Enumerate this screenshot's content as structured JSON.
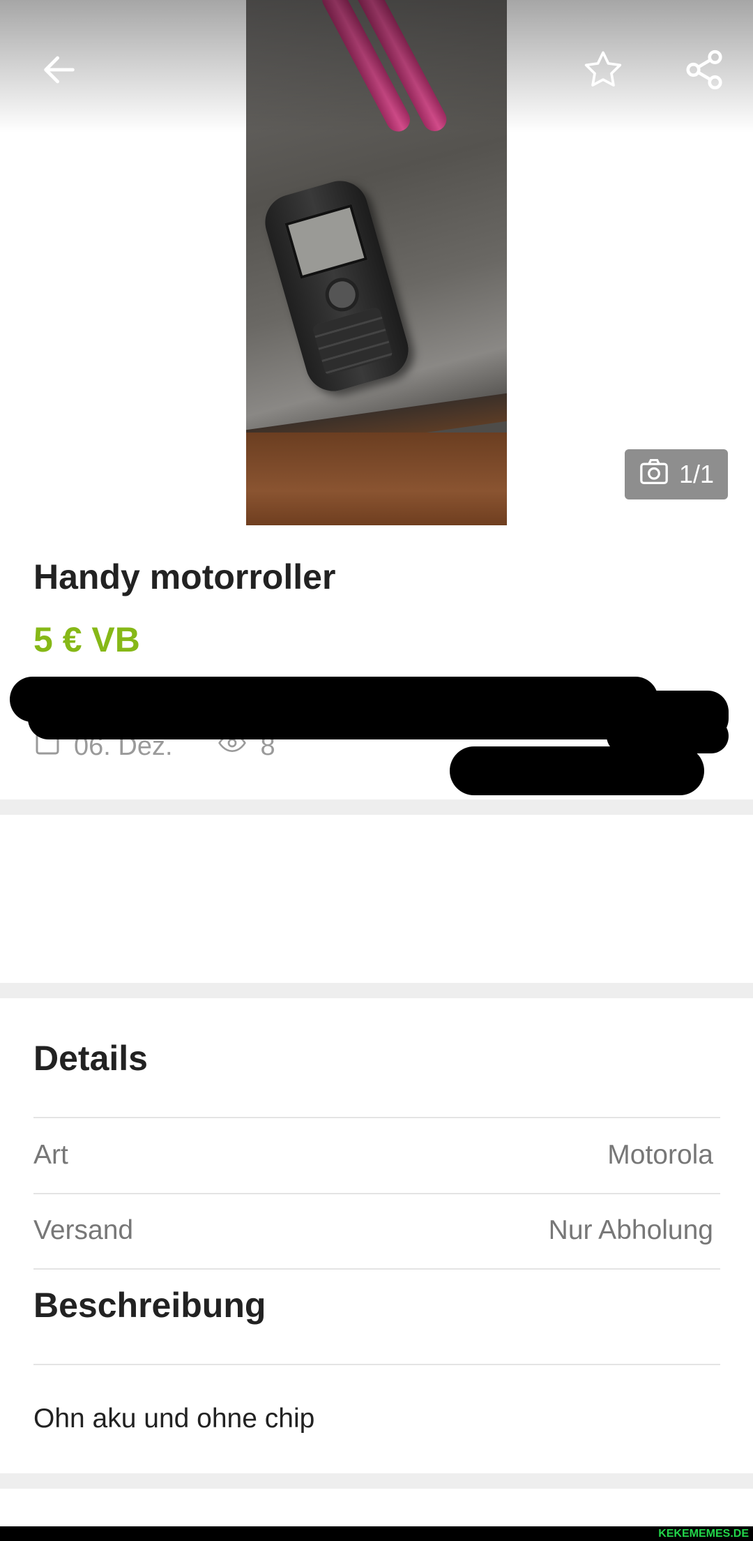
{
  "header": {
    "back_icon": "arrow-left-icon",
    "favorite_icon": "star-outline-icon",
    "share_icon": "share-icon"
  },
  "gallery": {
    "counter": "1/1",
    "counter_icon": "camera-icon"
  },
  "listing": {
    "title": "Handy motorroller",
    "price": "5 € VB",
    "date": "06. Dez.",
    "views": "8"
  },
  "details": {
    "heading": "Details",
    "rows": [
      {
        "label": "Art",
        "value": "Motorola"
      },
      {
        "label": "Versand",
        "value": "Nur Abholung"
      }
    ]
  },
  "description": {
    "heading": "Beschreibung",
    "text": "Ohn aku und ohne chip"
  },
  "watermark": "KEKEMEMES.DE",
  "colors": {
    "price": "#86b817",
    "separator": "#eeeeee",
    "text": "#222222",
    "muted": "#777777"
  }
}
